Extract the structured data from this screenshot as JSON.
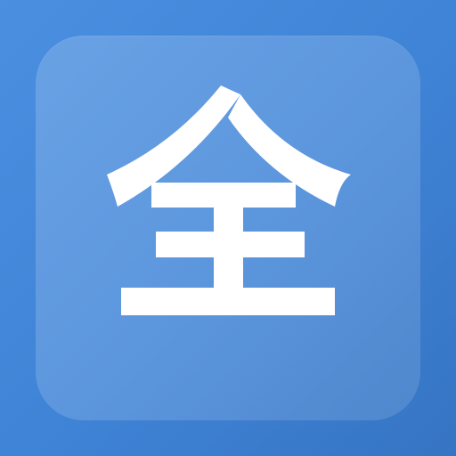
{
  "app_icon": {
    "glyph_text": "全",
    "colors": {
      "background_start": "#4a8fe0",
      "background_end": "#3674c3",
      "tile": "#ffffff",
      "glyph": "#ffffff"
    }
  }
}
